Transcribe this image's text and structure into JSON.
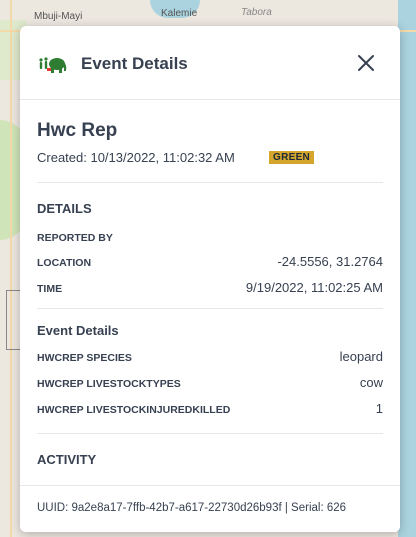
{
  "map": {
    "labels": [
      "Mbuji-Mayi",
      "Kalemie",
      "Tabora"
    ]
  },
  "panel": {
    "header_title": "Event Details",
    "logo_icon": "elephant-people-icon",
    "close_icon": "close-icon",
    "event_title": "Hwc Rep",
    "created_text": "Created: 10/13/2022, 11:02:32 AM",
    "status_badge": "GREEN",
    "details": {
      "title": "DETAILS",
      "reported_by_label": "REPORTED BY",
      "location_label": "LOCATION",
      "location_value": "-24.5556, 31.2764",
      "time_label": "TIME",
      "time_value": "9/19/2022, 11:02:25 AM"
    },
    "event_details": {
      "title": "Event Details",
      "rows": [
        {
          "label": "HWCREP SPECIES",
          "value": "leopard"
        },
        {
          "label": "HWCREP LIVESTOCKTYPES",
          "value": "cow"
        },
        {
          "label": "HWCREP LIVESTOCKINJUREDKILLED",
          "value": "1"
        }
      ]
    },
    "activity_title": "ACTIVITY",
    "footer_text": "UUID: 9a2e8a17-7ffb-42b7-a617-22730d26b93f | Serial: 626"
  },
  "colors": {
    "badge": "#d4a72c",
    "logo_green": "#2e7d32",
    "map_bg": "#ece7df",
    "water": "#aad3df"
  }
}
